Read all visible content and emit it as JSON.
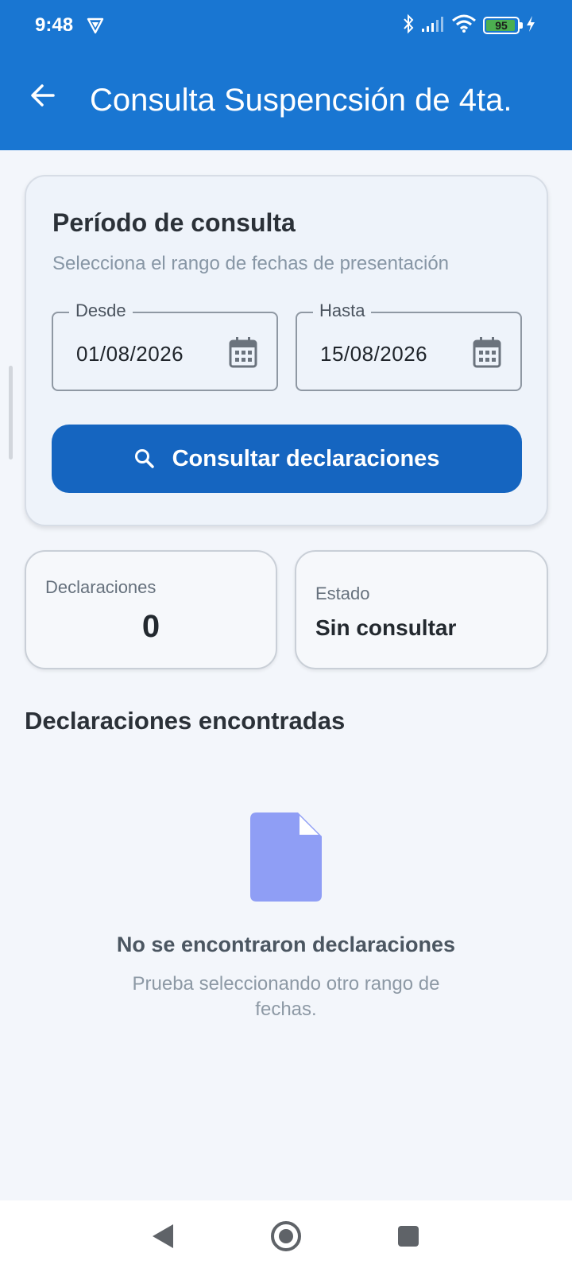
{
  "status_bar": {
    "time": "9:48",
    "battery_level": "95",
    "battery_fraction": 0.95,
    "icons": [
      "shield-icon",
      "bluetooth-icon",
      "signal-icon",
      "wifi-icon",
      "battery-icon",
      "charging-icon"
    ]
  },
  "app_bar": {
    "title": "Consulta Suspencsión de 4ta.",
    "back_icon": "arrow-back-icon",
    "color": "#1976d2"
  },
  "period_card": {
    "title": "Período de consulta",
    "subtitle": "Selecciona el rango de fechas de presentación",
    "from_label": "Desde",
    "from_value": "01/08/2026",
    "to_label": "Hasta",
    "to_value": "15/08/2026",
    "search_button": "Consultar declaraciones",
    "button_color": "#1565c0"
  },
  "stats": {
    "declarations_label": "Declaraciones",
    "declarations_value": "0",
    "status_label": "Estado",
    "status_value": "Sin consultar"
  },
  "results": {
    "title": "Declaraciones encontradas",
    "empty_title": "No se encontraron declaraciones",
    "empty_subtitle": "Prueba seleccionando otro rango de fechas.",
    "empty_icon": "document-icon",
    "empty_icon_color": "#8f9ef5"
  },
  "nav_bar": {
    "icons": [
      "nav-back-icon",
      "nav-home-icon",
      "nav-recents-icon"
    ]
  }
}
